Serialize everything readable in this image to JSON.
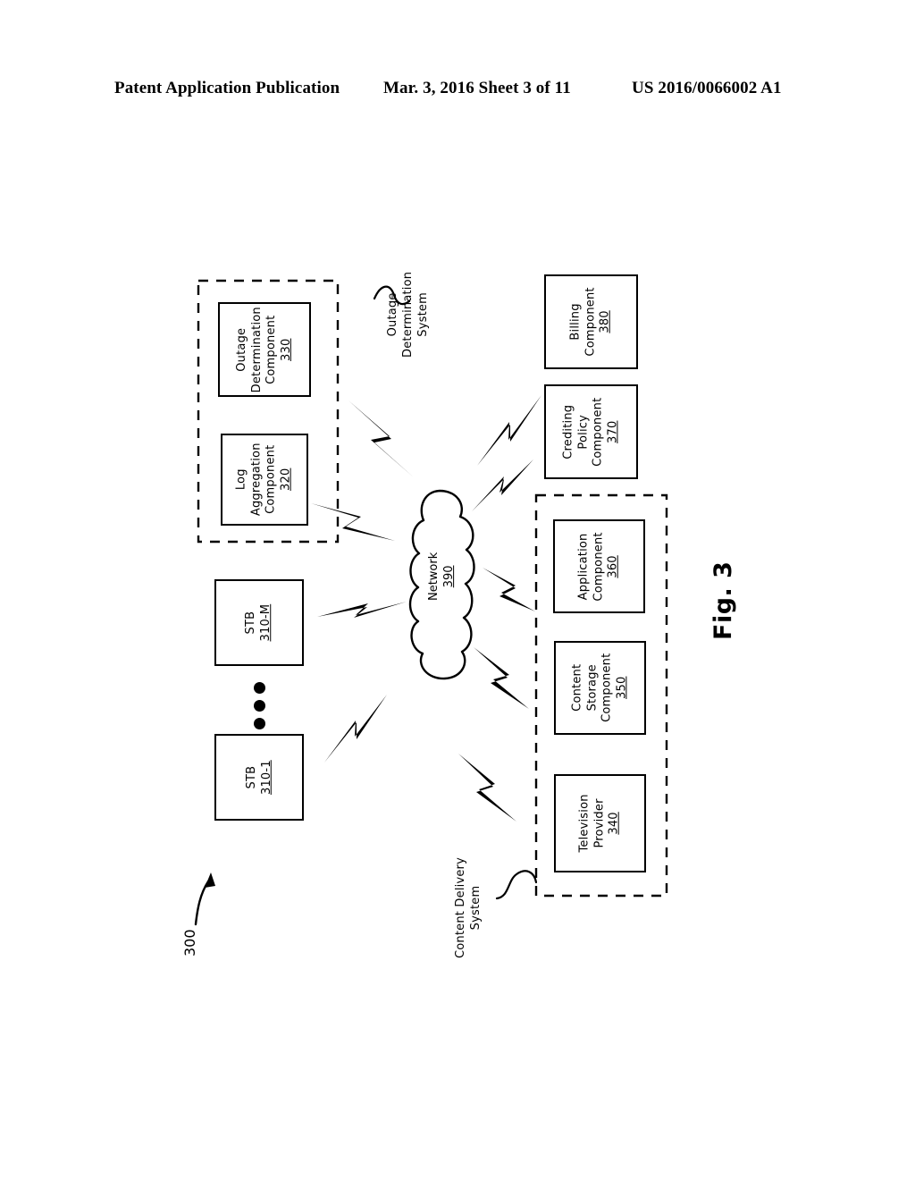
{
  "header": {
    "left": "Patent Application Publication",
    "middle": "Mar. 3, 2016  Sheet 3 of 11",
    "right": "US 2016/0066002 A1"
  },
  "figure": {
    "label": "Fig. 3",
    "reference_numeral": "300"
  },
  "diagram": {
    "type": "network-architecture",
    "groups": [
      {
        "id": "outage-determination-system",
        "label": "Outage\nDetermination\nSystem",
        "label_lines": [
          "Outage",
          "Determination",
          "System"
        ],
        "members": [
          "330",
          "320"
        ]
      },
      {
        "id": "content-delivery-system",
        "label": "Content Delivery\nSystem",
        "label_lines": [
          "Content Delivery",
          "System"
        ],
        "members": [
          "360",
          "350",
          "340"
        ]
      }
    ],
    "nodes": [
      {
        "id": "330",
        "name_lines": [
          "Outage",
          "Determination",
          "Component"
        ],
        "numeral": "330"
      },
      {
        "id": "320",
        "name_lines": [
          "Log",
          "Aggregation",
          "Component"
        ],
        "numeral": "320"
      },
      {
        "id": "310-M",
        "name_lines": [
          "STB"
        ],
        "numeral": "310-M"
      },
      {
        "id": "310-1",
        "name_lines": [
          "STB"
        ],
        "numeral": "310-1"
      },
      {
        "id": "390",
        "name_lines": [
          "Network"
        ],
        "numeral": "390",
        "shape": "cloud"
      },
      {
        "id": "380",
        "name_lines": [
          "Billing",
          "Component"
        ],
        "numeral": "380"
      },
      {
        "id": "370",
        "name_lines": [
          "Crediting",
          "Policy",
          "Component"
        ],
        "numeral": "370"
      },
      {
        "id": "360",
        "name_lines": [
          "Application",
          "Component"
        ],
        "numeral": "360"
      },
      {
        "id": "350",
        "name_lines": [
          "Content",
          "Storage",
          "Component"
        ],
        "numeral": "350"
      },
      {
        "id": "340",
        "name_lines": [
          "Television",
          "Provider"
        ],
        "numeral": "340"
      }
    ],
    "links": [
      {
        "from": "390",
        "to": "330",
        "style": "lightning-bolt"
      },
      {
        "from": "390",
        "to": "320",
        "style": "lightning-bolt"
      },
      {
        "from": "390",
        "to": "310-M",
        "style": "lightning-bolt"
      },
      {
        "from": "390",
        "to": "310-1",
        "style": "lightning-bolt"
      },
      {
        "from": "390",
        "to": "380",
        "style": "lightning-bolt"
      },
      {
        "from": "390",
        "to": "370",
        "style": "lightning-bolt"
      },
      {
        "from": "390",
        "to": "360",
        "style": "lightning-bolt"
      },
      {
        "from": "390",
        "to": "350",
        "style": "lightning-bolt"
      },
      {
        "from": "390",
        "to": "340",
        "style": "lightning-bolt"
      }
    ],
    "ellipsis": "three-vertical-dots"
  },
  "colors": {
    "ink": "#000000",
    "paper": "#ffffff"
  }
}
